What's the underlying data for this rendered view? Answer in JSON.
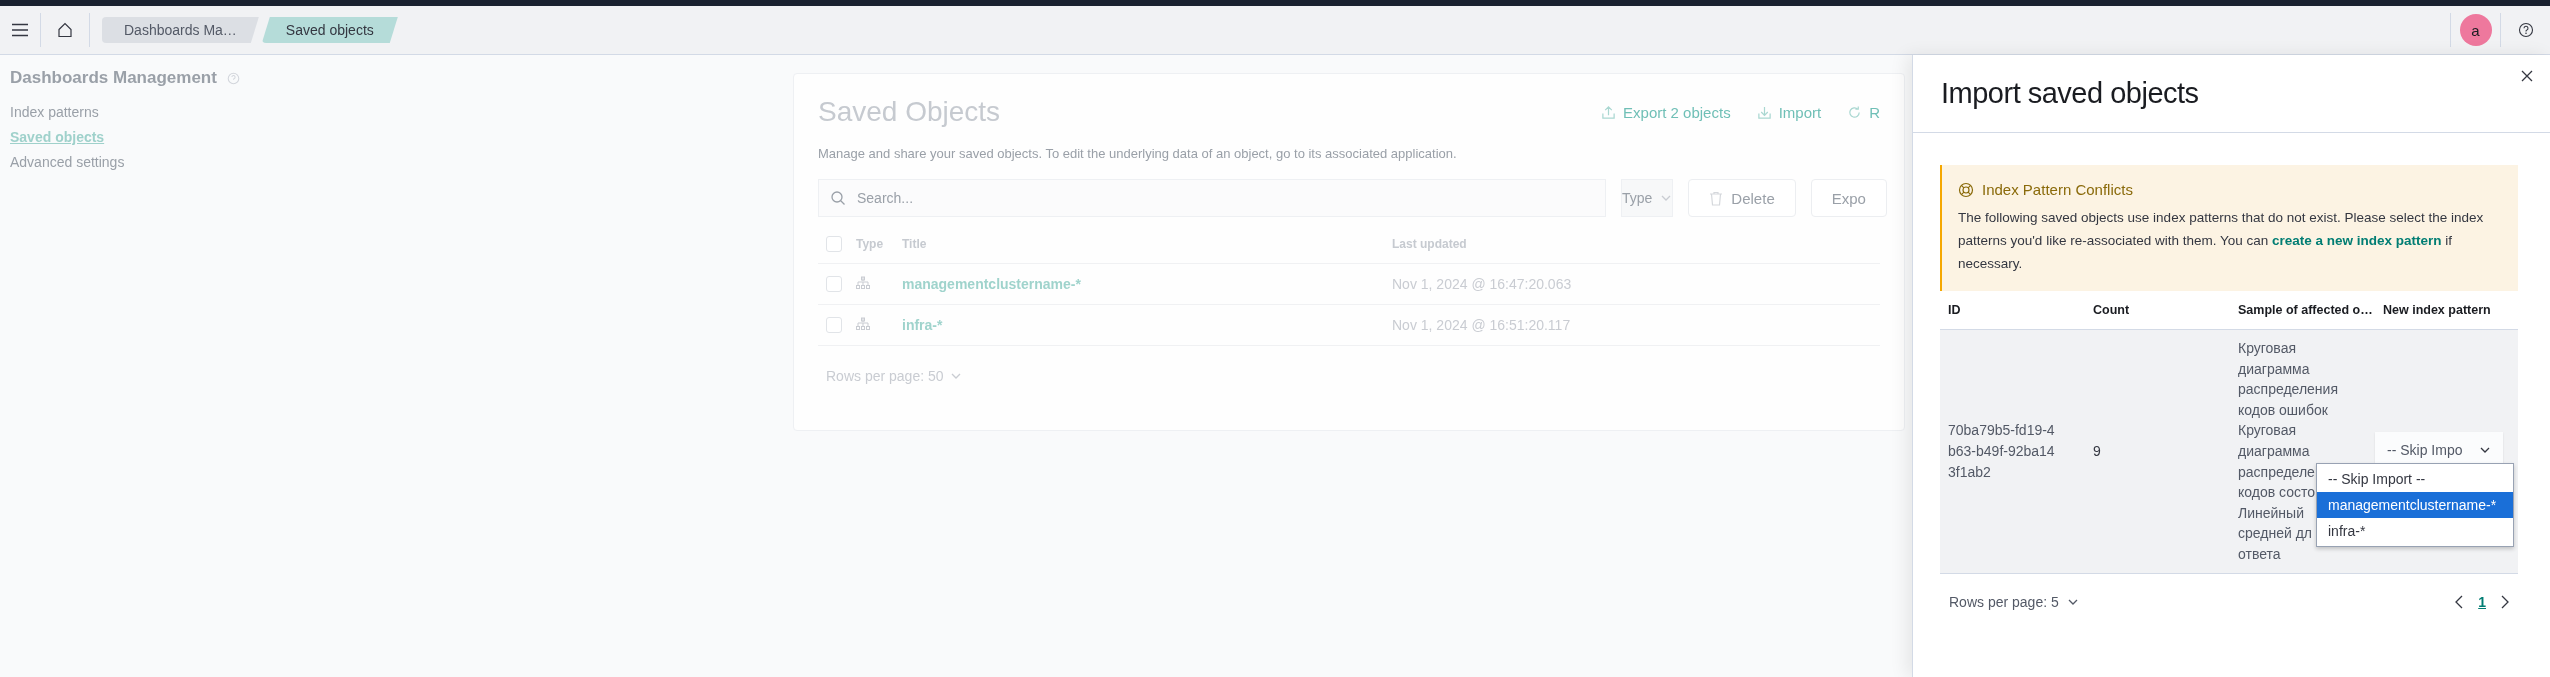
{
  "header": {
    "breadcrumbs": [
      {
        "label": "Dashboards Ma…",
        "selected": false
      },
      {
        "label": "Saved objects",
        "selected": true
      }
    ],
    "avatar": "a"
  },
  "sidebar": {
    "title": "Dashboards Management",
    "items": [
      {
        "label": "Index patterns",
        "selected": false
      },
      {
        "label": "Saved objects",
        "selected": true
      },
      {
        "label": "Advanced settings",
        "selected": false
      }
    ]
  },
  "main": {
    "title": "Saved Objects",
    "actions": [
      {
        "label": "Export 2 objects",
        "kind": "export"
      },
      {
        "label": "Import",
        "kind": "import"
      },
      {
        "label": "R",
        "kind": "refresh"
      }
    ],
    "description": "Manage and share your saved objects. To edit the underlying data of an object, go to its associated application.",
    "search": {
      "placeholder": "Search..."
    },
    "type_filter": "Type",
    "delete_button": "Delete",
    "export_button": "Expo",
    "table": {
      "select_all": {
        "checked": false
      },
      "columns": [
        "Type",
        "Title",
        "Last updated"
      ],
      "rows": [
        {
          "checked": false,
          "title": "managementclustername-*",
          "updated": "Nov 1, 2024 @ 16:47:20.063"
        },
        {
          "checked": false,
          "title": "infra-*",
          "updated": "Nov 1, 2024 @ 16:51:20.117"
        }
      ]
    },
    "rows_per_page": "Rows per page: 50"
  },
  "flyout": {
    "title": "Import saved objects",
    "callout": {
      "title": "Index Pattern Conflicts",
      "text_before": "The following saved objects use index patterns that do not exist. Please select the index patterns you'd like re-associated with them. You can ",
      "link": "create a new index pattern",
      "text_after": " if necessary."
    },
    "table": {
      "columns": [
        "ID",
        "Count",
        "Sample of affected o…",
        "New index pattern"
      ],
      "rows": [
        {
          "id": "70ba79b5-fd19-4b63-b49f-92ba143f1ab2",
          "count": "9",
          "sample_lines": [
            "Круговая",
            "диаграмма",
            "распределения",
            "кодов ошибок",
            "Круговая",
            "диаграмма",
            "распределе",
            "кодов состо",
            "Линейный",
            "средней дл",
            "ответа"
          ],
          "select_value": "-- Skip Impo",
          "options": [
            {
              "label": "-- Skip Import --",
              "selected": false
            },
            {
              "label": "managementclustername-*",
              "selected": true
            },
            {
              "label": "infra-*",
              "selected": false
            }
          ]
        }
      ]
    },
    "rows_per_page": "Rows per page: 5",
    "pages": [
      {
        "label": "1",
        "selected": true
      }
    ]
  }
}
